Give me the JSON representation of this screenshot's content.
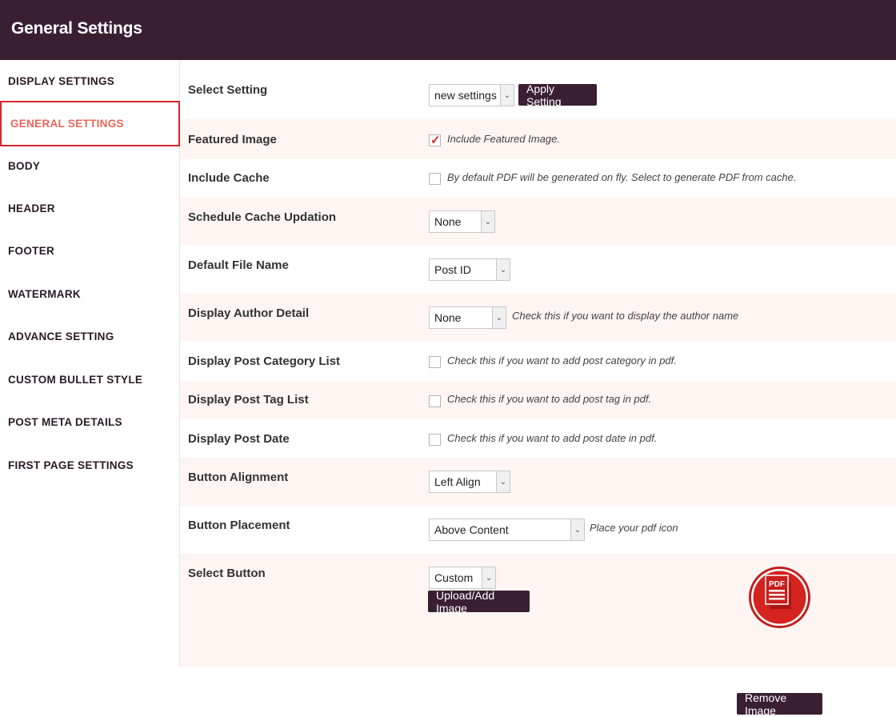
{
  "header": {
    "title": "General Settings"
  },
  "sidebar": {
    "items": [
      {
        "label": "DISPLAY SETTINGS"
      },
      {
        "label": "GENERAL SETTINGS"
      },
      {
        "label": "BODY"
      },
      {
        "label": "HEADER"
      },
      {
        "label": "FOOTER"
      },
      {
        "label": "WATERMARK"
      },
      {
        "label": "ADVANCE SETTING"
      },
      {
        "label": "CUSTOM BULLET STYLE"
      },
      {
        "label": "POST META DETAILS"
      },
      {
        "label": "FIRST PAGE SETTINGS"
      }
    ],
    "active_index": 1
  },
  "form": {
    "select_setting": {
      "label": "Select Setting",
      "value": "new settings",
      "apply_label": "Apply Setting"
    },
    "featured_image": {
      "label": "Featured Image",
      "hint": "Include Featured Image.",
      "checked": true
    },
    "include_cache": {
      "label": "Include Cache",
      "hint": "By default PDF will be generated on fly. Select to generate PDF from cache.",
      "checked": false
    },
    "schedule_cache": {
      "label": "Schedule Cache Updation",
      "value": "None"
    },
    "default_file_name": {
      "label": "Default File Name",
      "value": "Post ID"
    },
    "author_detail": {
      "label": "Display Author Detail",
      "value": "None",
      "hint": "Check this if you want to display the author name"
    },
    "post_category": {
      "label": "Display Post Category List",
      "hint": "Check this if you want to add post category in pdf.",
      "checked": false
    },
    "post_tag": {
      "label": "Display Post Tag List",
      "hint": "Check this if you want to add post tag in pdf.",
      "checked": false
    },
    "post_date": {
      "label": "Display Post Date",
      "hint": "Check this if you want to add post date in pdf.",
      "checked": false
    },
    "button_alignment": {
      "label": "Button Alignment",
      "value": "Left Align"
    },
    "button_placement": {
      "label": "Button Placement",
      "value": "Above Content",
      "hint": "Place your pdf icon"
    },
    "select_button": {
      "label": "Select Button",
      "value": "Custom",
      "upload_label": "Upload/Add Image",
      "remove_label": "Remove Image",
      "icon": "pdf-document-icon",
      "icon_text": "PDF"
    }
  },
  "colors": {
    "header_bg": "#3a1f33",
    "accent": "#d9252b",
    "active_text": "#e8665a",
    "row_alt": "#fff5f2"
  }
}
